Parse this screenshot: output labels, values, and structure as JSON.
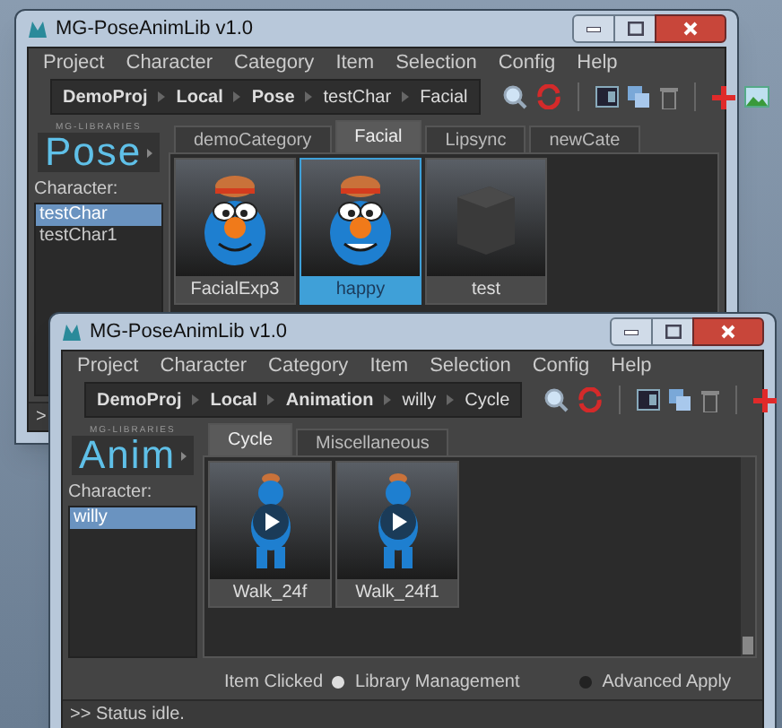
{
  "windows": [
    {
      "title": "MG-PoseAnimLib v1.0",
      "menu": [
        "Project",
        "Character",
        "Category",
        "Item",
        "Selection",
        "Config",
        "Help"
      ],
      "breadcrumb": [
        {
          "label": "DemoProj",
          "bold": true
        },
        {
          "label": "Local",
          "bold": true
        },
        {
          "label": "Pose",
          "bold": true
        },
        {
          "label": "testChar",
          "bold": false
        },
        {
          "label": "Facial",
          "bold": false
        }
      ],
      "logo_small": "MG-LIBRARIES",
      "logo": "Pose",
      "character_label": "Character:",
      "characters": [
        {
          "name": "testChar",
          "selected": true
        },
        {
          "name": "testChar1",
          "selected": false
        }
      ],
      "tabs": [
        {
          "label": "demoCategory",
          "selected": false
        },
        {
          "label": "Facial",
          "selected": true
        },
        {
          "label": "Lipsync",
          "selected": false
        },
        {
          "label": "newCate",
          "selected": false
        }
      ],
      "items": [
        {
          "name": "FacialExp3",
          "kind": "face",
          "selected": false
        },
        {
          "name": "happy",
          "kind": "face",
          "selected": true
        },
        {
          "name": "test",
          "kind": "cube",
          "selected": false
        }
      ],
      "status": ">"
    },
    {
      "title": "MG-PoseAnimLib v1.0",
      "menu": [
        "Project",
        "Character",
        "Category",
        "Item",
        "Selection",
        "Config",
        "Help"
      ],
      "breadcrumb": [
        {
          "label": "DemoProj",
          "bold": true
        },
        {
          "label": "Local",
          "bold": true
        },
        {
          "label": "Animation",
          "bold": true
        },
        {
          "label": "willy",
          "bold": false
        },
        {
          "label": "Cycle",
          "bold": false
        }
      ],
      "logo_small": "MG-LIBRARIES",
      "logo": "Anim",
      "character_label": "Character:",
      "characters": [
        {
          "name": "willy",
          "selected": true
        }
      ],
      "tabs": [
        {
          "label": "Cycle",
          "selected": true
        },
        {
          "label": "Miscellaneous",
          "selected": false
        }
      ],
      "items": [
        {
          "name": "Walk_24f",
          "kind": "anim",
          "selected": false
        },
        {
          "name": "Walk_24f1",
          "kind": "anim",
          "selected": false
        }
      ],
      "item_clicked_label": "Item Clicked",
      "options": [
        {
          "label": "Library Management",
          "selected": true
        },
        {
          "label": "Advanced Apply",
          "selected": false
        }
      ],
      "status": ">> Status idle."
    }
  ]
}
